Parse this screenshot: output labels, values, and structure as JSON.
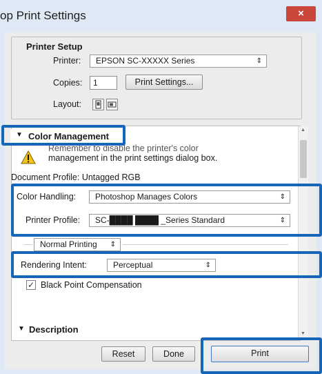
{
  "window": {
    "title": "op Print Settings",
    "close_glyph": "×"
  },
  "printer_setup": {
    "title": "Printer Setup",
    "printer_label": "Printer:",
    "printer_value": "EPSON SC-XXXXX Series",
    "copies_label": "Copies:",
    "copies_value": "1",
    "print_settings_button": "Print Settings...",
    "layout_label": "Layout:"
  },
  "color_management": {
    "title": "Color Management",
    "caret": "▼",
    "notice_line1": "Remember to disable the printer's color",
    "notice_line2": "management in the print settings dialog box.",
    "document_profile": "Document Profile: Untagged RGB",
    "color_handling_label": "Color Handling:",
    "color_handling_value": "Photoshop Manages Colors",
    "printer_profile_label": "Printer Profile:",
    "printer_profile_value": "SC-████ ████ _Series Standard",
    "printing_mode_value": "Normal Printing",
    "rendering_intent_label": "Rendering Intent:",
    "rendering_intent_value": "Perceptual",
    "black_point_label": "Black Point Compensation",
    "black_point_checked": true
  },
  "description": {
    "title": "Description",
    "caret": "▼"
  },
  "footer": {
    "reset_label": "Reset",
    "done_label": "Done",
    "print_label": "Print"
  },
  "colors": {
    "highlight": "#1565b8",
    "close": "#c9463d",
    "titlebar": "#dfe9f5"
  },
  "icons": [
    "close-icon",
    "portrait-layout-icon",
    "landscape-layout-icon",
    "warning-icon",
    "dropdown-arrow-icon",
    "checkmark-icon"
  ]
}
